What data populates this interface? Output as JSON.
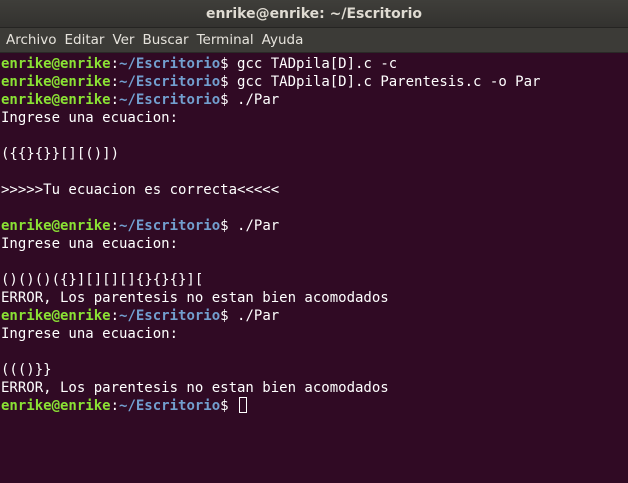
{
  "window": {
    "title": "enrike@enrike: ~/Escritorio"
  },
  "menubar": {
    "items": [
      "Archivo",
      "Editar",
      "Ver",
      "Buscar",
      "Terminal",
      "Ayuda"
    ]
  },
  "prompt": {
    "user": "enrike@enrike",
    "sep": ":",
    "path": "~/Escritorio",
    "sigil": "$"
  },
  "terminal": {
    "lines": [
      {
        "kind": "prompt",
        "cmd": " gcc TADpila[D].c -c"
      },
      {
        "kind": "prompt",
        "cmd": " gcc TADpila[D].c Parentesis.c -o Par"
      },
      {
        "kind": "prompt",
        "cmd": " ./Par"
      },
      {
        "kind": "out",
        "text": "Ingrese una ecuacion:"
      },
      {
        "kind": "out",
        "text": ""
      },
      {
        "kind": "out",
        "text": "({{}{}}[][()])"
      },
      {
        "kind": "out",
        "text": ""
      },
      {
        "kind": "out",
        "text": ">>>>>Tu ecuacion es correcta<<<<<"
      },
      {
        "kind": "out",
        "text": ""
      },
      {
        "kind": "prompt",
        "cmd": " ./Par"
      },
      {
        "kind": "out",
        "text": "Ingrese una ecuacion:"
      },
      {
        "kind": "out",
        "text": ""
      },
      {
        "kind": "out",
        "text": "()()()({}][][][]{}{}{}]["
      },
      {
        "kind": "out",
        "text": "ERROR, Los parentesis no estan bien acomodados"
      },
      {
        "kind": "prompt",
        "cmd": " ./Par"
      },
      {
        "kind": "out",
        "text": "Ingrese una ecuacion:"
      },
      {
        "kind": "out",
        "text": ""
      },
      {
        "kind": "out",
        "text": "((()}}"
      },
      {
        "kind": "out",
        "text": "ERROR, Los parentesis no estan bien acomodados"
      },
      {
        "kind": "prompt",
        "cmd": " ",
        "cursor": true
      }
    ]
  },
  "colors": {
    "background": "#300a24",
    "user": "#8ae234",
    "path": "#729fcf",
    "text": "#ffffff"
  }
}
